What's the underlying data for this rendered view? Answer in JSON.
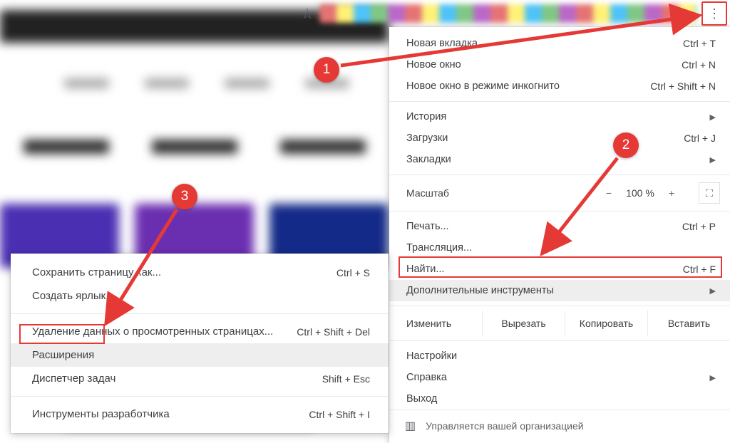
{
  "annotations": {
    "b1": "1",
    "b2": "2",
    "b3": "3"
  },
  "toolbar": {
    "star_glyph": "☆",
    "kebab_glyph": "⋮"
  },
  "menu": {
    "new_tab": {
      "label": "Новая вкладка",
      "shortcut": "Ctrl + T"
    },
    "new_window": {
      "label": "Новое окно",
      "shortcut": "Ctrl + N"
    },
    "incognito": {
      "label": "Новое окно в режиме инкогнито",
      "shortcut": "Ctrl + Shift + N"
    },
    "history": {
      "label": "История"
    },
    "downloads": {
      "label": "Загрузки",
      "shortcut": "Ctrl + J"
    },
    "bookmarks": {
      "label": "Закладки"
    },
    "zoom": {
      "label": "Масштаб",
      "minus": "−",
      "value": "100 %",
      "plus": "+",
      "fs_glyph": "⛶"
    },
    "print": {
      "label": "Печать...",
      "shortcut": "Ctrl + P"
    },
    "cast": {
      "label": "Трансляция..."
    },
    "find": {
      "label": "Найти...",
      "shortcut": "Ctrl + F"
    },
    "more_tools": {
      "label": "Дополнительные инструменты"
    },
    "edit": {
      "label": "Изменить",
      "cut": "Вырезать",
      "copy": "Копировать",
      "paste": "Вставить"
    },
    "settings": {
      "label": "Настройки"
    },
    "help": {
      "label": "Справка"
    },
    "exit": {
      "label": "Выход"
    },
    "managed": {
      "label": "Управляется вашей организацией",
      "icon": "▥"
    }
  },
  "submenu": {
    "save_page": {
      "label": "Сохранить страницу как...",
      "shortcut": "Ctrl + S"
    },
    "create_shortcut": {
      "label": "Создать ярлык..."
    },
    "clear_data": {
      "label": "Удаление данных о просмотренных страницах...",
      "shortcut": "Ctrl + Shift + Del"
    },
    "extensions": {
      "label": "Расширения"
    },
    "task_mgr": {
      "label": "Диспетчер задач",
      "shortcut": "Shift + Esc"
    },
    "dev_tools": {
      "label": "Инструменты разработчика",
      "shortcut": "Ctrl + Shift + I"
    }
  }
}
